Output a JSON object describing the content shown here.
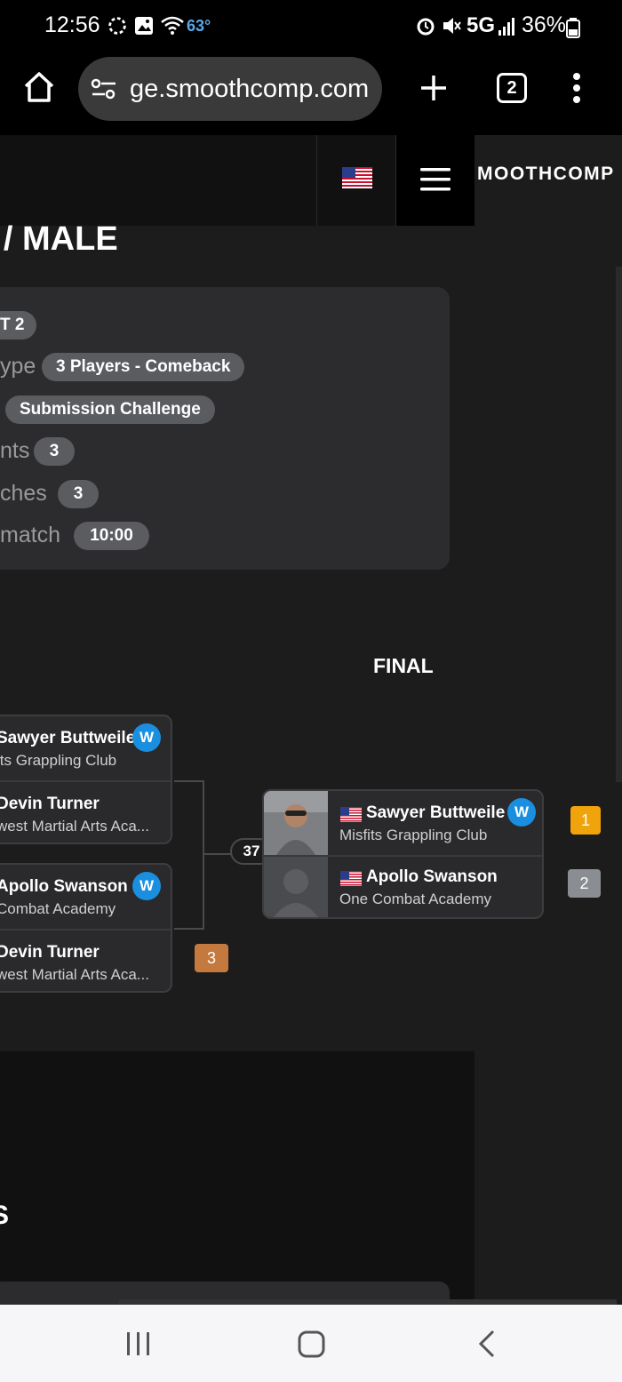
{
  "status": {
    "time": "12:56",
    "temperature": "63°",
    "network": "5G",
    "battery": "36%"
  },
  "browser": {
    "url": "ge.smoothcomp.com",
    "tab_count": "2"
  },
  "site": {
    "brand": "MOOTHCOMP"
  },
  "page": {
    "title": "S / MALE"
  },
  "info": {
    "bracket_pill": "T 2",
    "type_label": "ype",
    "type_value": "3 Players - Comeback",
    "ruleset_value": "Submission Challenge",
    "participants_label": "nts",
    "participants_value": "3",
    "matches_label": "ches",
    "matches_value": "3",
    "match_time_label": "match",
    "match_time_value": "10:00"
  },
  "bracket": {
    "final_label": "FINAL",
    "match_number": "37",
    "semis": [
      {
        "top": {
          "name": "Sawyer Buttweile",
          "club": "its Grappling Club",
          "winner": "W"
        },
        "bottom": {
          "name": "Devin Turner",
          "club": "west Martial Arts Aca..."
        }
      },
      {
        "top": {
          "name": "Apollo Swanson",
          "club": "Combat Academy",
          "winner": "W"
        },
        "bottom": {
          "name": "Devin Turner",
          "club": "west Martial Arts Aca..."
        },
        "rank": "3"
      }
    ],
    "final": {
      "top": {
        "name": "Sawyer Buttweile",
        "club": "Misfits Grappling Club",
        "winner": "W",
        "rank": "1"
      },
      "bottom": {
        "name": "Apollo Swanson",
        "club": "One Combat Academy",
        "rank": "2"
      }
    }
  },
  "lower": {
    "fragment": "S"
  },
  "colors": {
    "winner_badge": "#1a8fe0",
    "gold": "#f0a30a",
    "silver": "#8a8d91",
    "bronze": "#c47a3f"
  }
}
